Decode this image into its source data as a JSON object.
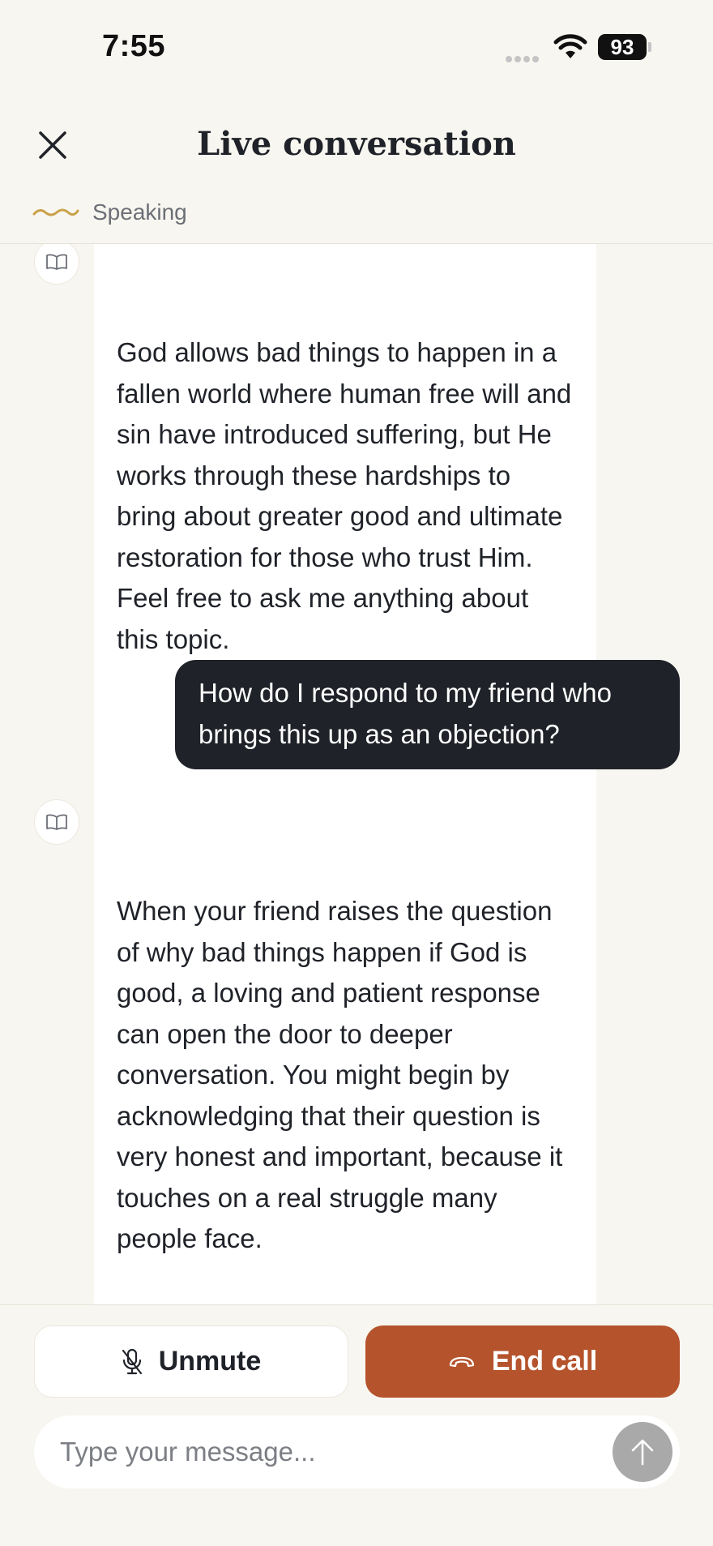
{
  "status_bar": {
    "time": "7:55",
    "battery": "93"
  },
  "header": {
    "title": "Live conversation",
    "speaking_label": "Speaking"
  },
  "messages": [
    {
      "role": "assistant",
      "text": "God allows bad things to happen in a fallen world where human free will and sin have introduced suffering, but He works through these hardships to bring about greater good and ultimate restoration for those who trust Him. Feel free to ask me anything about this topic."
    },
    {
      "role": "user",
      "text": "How do I respond to my friend who brings this up as an objection?"
    },
    {
      "role": "assistant",
      "text": "When your friend raises the question of why bad things happen if God is good, a loving and patient response can open the door to deeper conversation. You might begin by acknowledging that their question is very honest and important, because it touches on a real struggle many people face.\n\nYou can"
    }
  ],
  "controls": {
    "unmute_label": "Unmute",
    "end_call_label": "End call"
  },
  "composer": {
    "placeholder": "Type your message...",
    "value": ""
  },
  "colors": {
    "accent_end_call": "#b5532c",
    "user_bubble": "#1f2228",
    "background": "#f8f6f0",
    "speaking_wave": "#c9a24a"
  },
  "icons": {
    "close": "close-icon",
    "speaking": "speaking-wave-icon",
    "assistant_avatar": "book-icon",
    "flag": "flag-icon",
    "mic": "mic-off-icon",
    "end_call": "phone-hangup-icon",
    "send": "arrow-up-icon"
  }
}
